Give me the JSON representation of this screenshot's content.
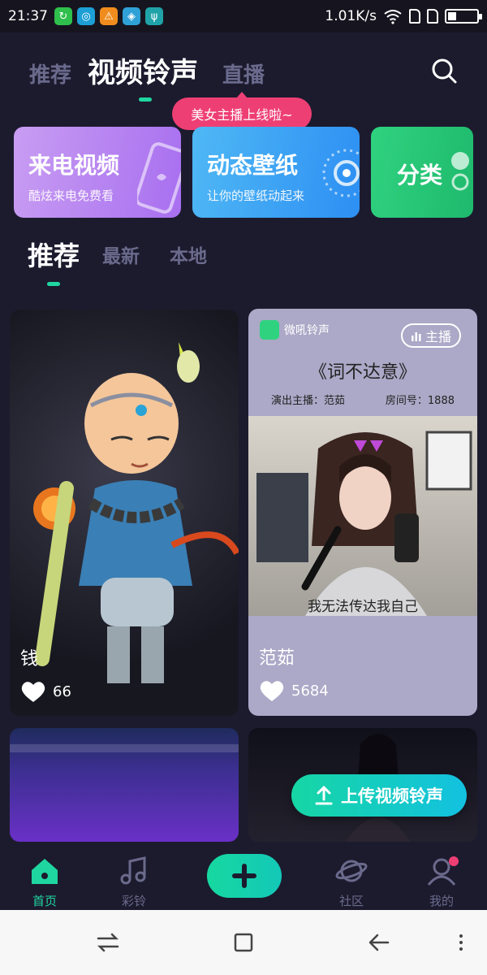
{
  "status_bar": {
    "time": "21:37",
    "network_speed": "1.01K/s"
  },
  "top_nav": {
    "tabs": [
      "推荐",
      "视频铃声",
      "直播"
    ],
    "active_tab": "视频铃声"
  },
  "tooltip": "美女主播上线啦~",
  "features": [
    {
      "title": "来电视频",
      "subtitle": "酷炫来电免费看",
      "color": "#b884f1"
    },
    {
      "title": "动态壁纸",
      "subtitle": "让你的壁纸动起来",
      "color": "#3aa3f4"
    },
    {
      "title": "分类",
      "subtitle": "",
      "color": "#27c677"
    }
  ],
  "sub_tabs": [
    "推荐",
    "最新",
    "本地"
  ],
  "cards": [
    {
      "name": "钱",
      "likes": "66"
    },
    {
      "name": "范茹",
      "likes": "5684",
      "badge": "主播",
      "app_label": "微吼铃声",
      "song_title": "《词不达意》",
      "singer_label": "演出主播：范茹",
      "room_label": "房间号：1888",
      "lyric": "我无法传达我自己"
    }
  ],
  "upload_button": "上传视频铃声",
  "bottom_nav": [
    {
      "label": "首页",
      "icon": "home-icon",
      "active": true
    },
    {
      "label": "彩铃",
      "icon": "music-icon",
      "active": false
    },
    {
      "label": "",
      "icon": "plus-icon",
      "active": false
    },
    {
      "label": "社区",
      "icon": "planet-icon",
      "active": false
    },
    {
      "label": "我的",
      "icon": "profile-icon",
      "active": false
    }
  ],
  "colors": {
    "accent": "#1fd6a0",
    "background": "#1c1b2e",
    "pink": "#ee3f74"
  }
}
